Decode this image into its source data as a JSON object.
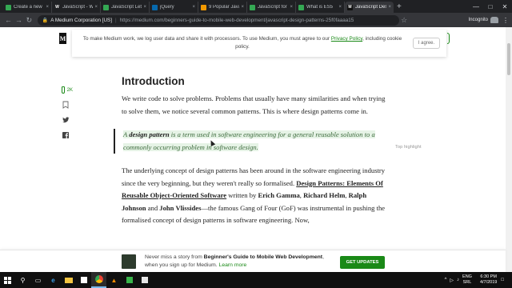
{
  "browser": {
    "tabs": [
      {
        "label": "Create a new",
        "fav_color": "#34a853",
        "fav_glyph": ""
      },
      {
        "label": "JavaScript - W",
        "fav_color": "#202124",
        "fav_glyph": "W"
      },
      {
        "label": "JavaScript Let",
        "fav_color": "#34a853",
        "fav_glyph": ""
      },
      {
        "label": "jQuery",
        "fav_color": "#0769ad",
        "fav_glyph": ""
      },
      {
        "label": "9 Popular Java",
        "fav_color": "#f29900",
        "fav_glyph": ""
      },
      {
        "label": "JavaScript for",
        "fav_color": "#34a853",
        "fav_glyph": ""
      },
      {
        "label": "What is ES5",
        "fav_color": "#34a853",
        "fav_glyph": ""
      },
      {
        "label": "JavaScript Des",
        "fav_color": "#111111",
        "fav_glyph": "M",
        "active": true
      }
    ],
    "address": {
      "cert": "A Medium Corporation [US]",
      "url": "https://medium.com/beginners-guide-to-mobile-web-development/javascript-design-patterns-25f0faaaa15"
    },
    "incognito_label": "Incognito"
  },
  "cookie_banner": {
    "text_before": "To make Medium work, we log user data and share it with processors. To use Medium, you must agree to our ",
    "link": "Privacy Policy",
    "text_after": ", including cookie policy.",
    "agree_label": "I agree."
  },
  "rail": {
    "clap_count": "2K"
  },
  "article": {
    "heading": "Introduction",
    "para1": "We write code to solve problems. Problems that usually have many similarities and when trying to solve them, we notice several common patterns. This is where design patterns come in.",
    "quote": {
      "prefix": "A ",
      "bold": "design pattern",
      "rest": " is a term used in software engineering for a general reusable solution to a commonly occurring problem in software design."
    },
    "top_highlight": "Top highlight",
    "para2": {
      "t1": "The underlying concept of design patterns has been around in the software engineering industry since the very beginning, but they weren't really so formalised. ",
      "book": "Design Patterns: Elements Of Reusable Object-Oriented Software",
      "t2": " written by ",
      "a1": "Erich Gamma",
      "c1": ", ",
      "a2": "Richard Helm",
      "c2": ", ",
      "a3": "Ralph Johnson",
      "t3": " and ",
      "a4": "John Vlissides",
      "t4": "—the famous Gang of Four (GoF) was instrumental in pushing the formalised concept of design patterns in software engineering. Now,"
    }
  },
  "footer": {
    "t1": "Never miss a story from ",
    "pub": "Beginner's Guide to Mobile Web Development",
    "t2": ", when you sign up for Medium. ",
    "learn": "Learn more",
    "button": "GET UPDATES"
  },
  "taskbar": {
    "lang_top": "ENG",
    "lang_bottom": "SRL",
    "time": "6:30 PM",
    "date": "4/7/2019"
  }
}
